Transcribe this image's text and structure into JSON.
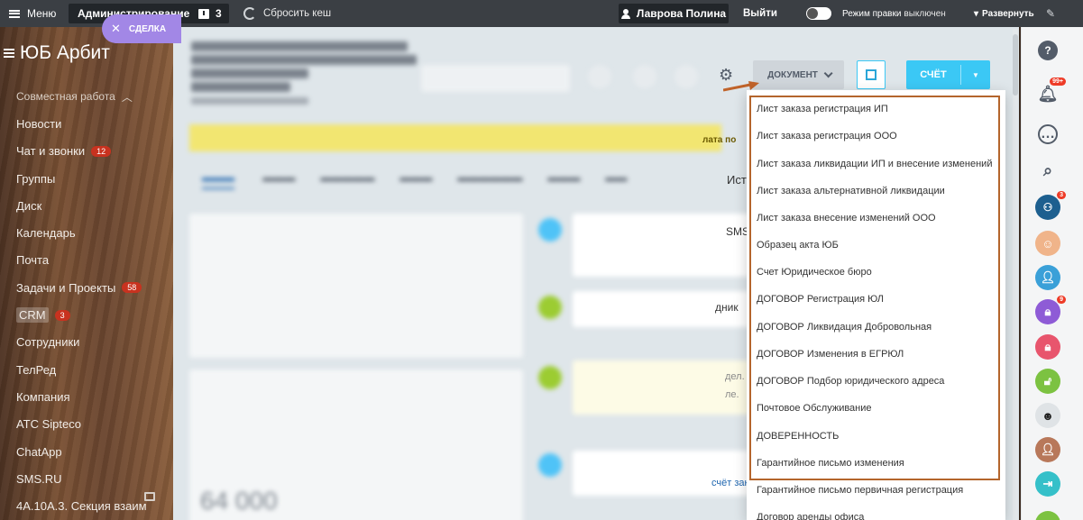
{
  "topbar": {
    "menu_label": "Меню",
    "admin_label": "Администрирование",
    "notification_count": "3",
    "cache_label": "Сбросить кеш",
    "user_name": "Лаврова Полина",
    "logout_label": "Выйти",
    "edit_mode_label": "Режим правки",
    "edit_mode_state": "выключен",
    "expand_label": "Развернуть"
  },
  "sidebar": {
    "brand": "ЮБ Арбит",
    "deal_label": "СДЕЛКА",
    "items": [
      {
        "label": "Совместная работа",
        "badge": ""
      },
      {
        "label": "Новости",
        "badge": ""
      },
      {
        "label": "Чат и звонки",
        "badge": "12"
      },
      {
        "label": "Группы",
        "badge": ""
      },
      {
        "label": "Диск",
        "badge": ""
      },
      {
        "label": "Календарь",
        "badge": ""
      },
      {
        "label": "Почта",
        "badge": ""
      },
      {
        "label": "Задачи и Проекты",
        "badge": "58"
      },
      {
        "label": "CRM",
        "badge": "3"
      },
      {
        "label": "Сотрудники",
        "badge": ""
      },
      {
        "label": "ТелРед",
        "badge": ""
      },
      {
        "label": "Компания",
        "badge": ""
      },
      {
        "label": "АТС Sipteco",
        "badge": ""
      },
      {
        "label": "ChatApp",
        "badge": ""
      },
      {
        "label": "SMS.RU",
        "badge": ""
      },
      {
        "label": "4А.10А.3. Секция взаим",
        "badge": ""
      }
    ]
  },
  "toolbar": {
    "document_label": "ДОКУМЕНТ",
    "invoice_label": "СЧЁТ"
  },
  "deal": {
    "amount": "64 000",
    "tab_partial": "Ист",
    "stage_partial": "лата по",
    "sms_label": "SMS",
    "partial_1": "дник",
    "partial_2": "дел. П",
    "partial_3": "ле.",
    "partial_4": "счёт заказ"
  },
  "document_menu": {
    "items": [
      "Лист заказа регистрация ИП",
      "Лист заказа регистрация ООО",
      "Лист заказа ликвидации ИП и внесение изменений",
      "Лист заказа альтернативной ликвидации",
      "Лист заказа внесение изменений ООО",
      "Образец акта ЮБ",
      "Счет Юридическое бюро",
      "ДОГОВОР Регистрация ЮЛ",
      "ДОГОВОР Ликвидация Добровольная",
      "ДОГОВОР Изменения в ЕГРЮЛ",
      "ДОГОВОР Подбор юридического адреса",
      "Почтовое Обслуживание",
      "ДОВЕРЕННОСТЬ",
      "Гарантийное письмо изменения",
      "Гарантийное письмо первичная регистрация",
      "Договор аренды офиса"
    ]
  },
  "rail": {
    "notifications_badge": "99+",
    "group_badge": "3",
    "lock_badge": "9"
  },
  "colors": {
    "accent_blue": "#3bc8f5",
    "highlight_frame": "#b4652c",
    "deal_button": "#a287e6",
    "badge_red": "#c8321f"
  }
}
